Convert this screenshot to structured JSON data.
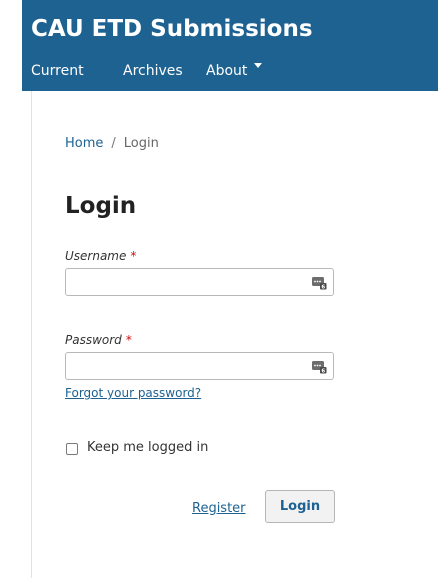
{
  "header": {
    "site_title": "CAU ETD Submissions",
    "nav": [
      "Current",
      "Archives",
      "About"
    ],
    "bg_color": "#1e6292"
  },
  "breadcrumb": {
    "home": "Home",
    "separator": "/",
    "current": "Login"
  },
  "page_title": "Login",
  "form": {
    "username_label": "Username",
    "password_label": "Password",
    "required_mark": "*",
    "username_value": "",
    "password_value": "",
    "forgot_link": "Forgot your password?",
    "keep_logged_in_label": "Keep me logged in",
    "keep_logged_in_checked": false,
    "register_link": "Register",
    "login_button": "Login",
    "field_icon": "password-manager-icon"
  }
}
